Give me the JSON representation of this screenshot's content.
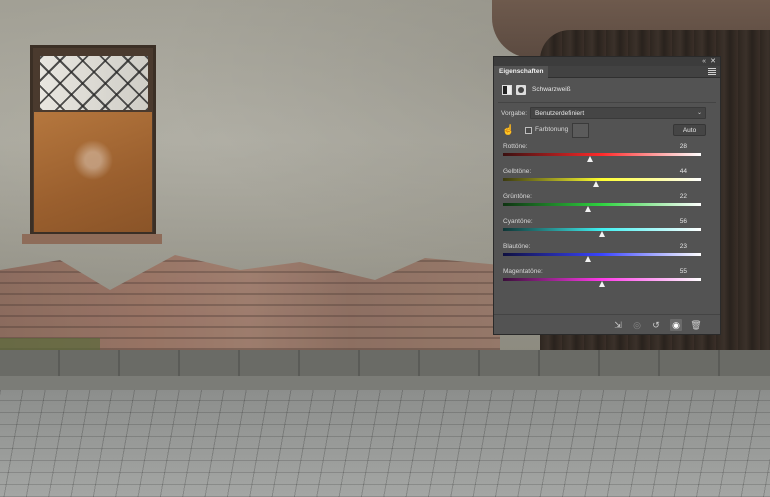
{
  "panel": {
    "tab_label": "Eigenschaften",
    "adjustment_title": "Schwarzweiß",
    "preset": {
      "label": "Vorgabe:",
      "value": "Benutzerdefiniert"
    },
    "tint": {
      "label": "Farbtonung",
      "checked": false
    },
    "auto_label": "Auto",
    "sliders": [
      {
        "label": "Rottöne:",
        "value": "28",
        "fraction": 0.44,
        "colors": [
          "#3a1010",
          "#ff2a2a"
        ]
      },
      {
        "label": "Gelbtöne:",
        "value": "44",
        "fraction": 0.47,
        "colors": [
          "#3b3a10",
          "#ffff30"
        ]
      },
      {
        "label": "Grüntöne:",
        "value": "22",
        "fraction": 0.43,
        "colors": [
          "#0f3312",
          "#2fd340"
        ]
      },
      {
        "label": "Cyantöne:",
        "value": "56",
        "fraction": 0.5,
        "colors": [
          "#0f3535",
          "#40f0f0"
        ]
      },
      {
        "label": "Blautöne:",
        "value": "23",
        "fraction": 0.43,
        "colors": [
          "#0f1040",
          "#3a45ff"
        ]
      },
      {
        "label": "Magentatöne:",
        "value": "55",
        "fraction": 0.5,
        "colors": [
          "#3a0f3a",
          "#ff3ae8"
        ]
      }
    ],
    "icons": {
      "collapse": "double-chevron-icon",
      "close": "close-icon",
      "menu": "panel-menu-icon",
      "bw_layer": "black-white-adjustment-icon",
      "mask": "layer-mask-icon",
      "targeted_adjustment": "hand-icon",
      "clip": "clip-to-layer-icon",
      "view_previous": "view-previous-state-icon",
      "reset": "reset-icon",
      "visibility": "eye-icon",
      "delete": "trash-icon"
    }
  }
}
